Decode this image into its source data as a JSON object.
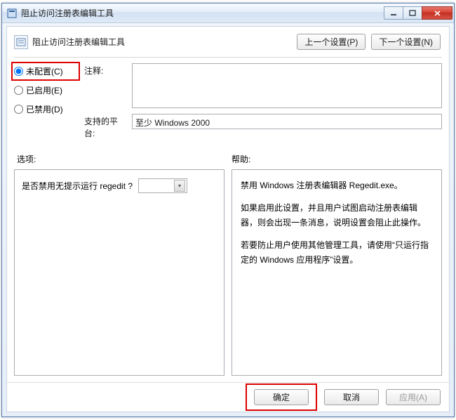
{
  "window": {
    "title": "阻止访问注册表编辑工具"
  },
  "header": {
    "title": "阻止访问注册表编辑工具",
    "prev": "上一个设置(P)",
    "next": "下一个设置(N)"
  },
  "radios": {
    "not_configured": "未配置(C)",
    "enabled": "已启用(E)",
    "disabled": "已禁用(D)"
  },
  "labels": {
    "comment": "注释:",
    "platform": "支持的平台:",
    "options": "选项:",
    "help": "帮助:"
  },
  "values": {
    "comment": "",
    "platform": "至少 Windows 2000"
  },
  "options": {
    "question": "是否禁用无提示运行 regedit ?",
    "selected": ""
  },
  "help": {
    "p1": "禁用 Windows 注册表编辑器 Regedit.exe。",
    "p2": "如果启用此设置，并且用户试图启动注册表编辑器，则会出现一条消息，说明设置会阻止此操作。",
    "p3": "若要防止用户使用其他管理工具，请使用“只运行指定的 Windows 应用程序”设置。"
  },
  "buttons": {
    "ok": "确定",
    "cancel": "取消",
    "apply": "应用(A)"
  }
}
